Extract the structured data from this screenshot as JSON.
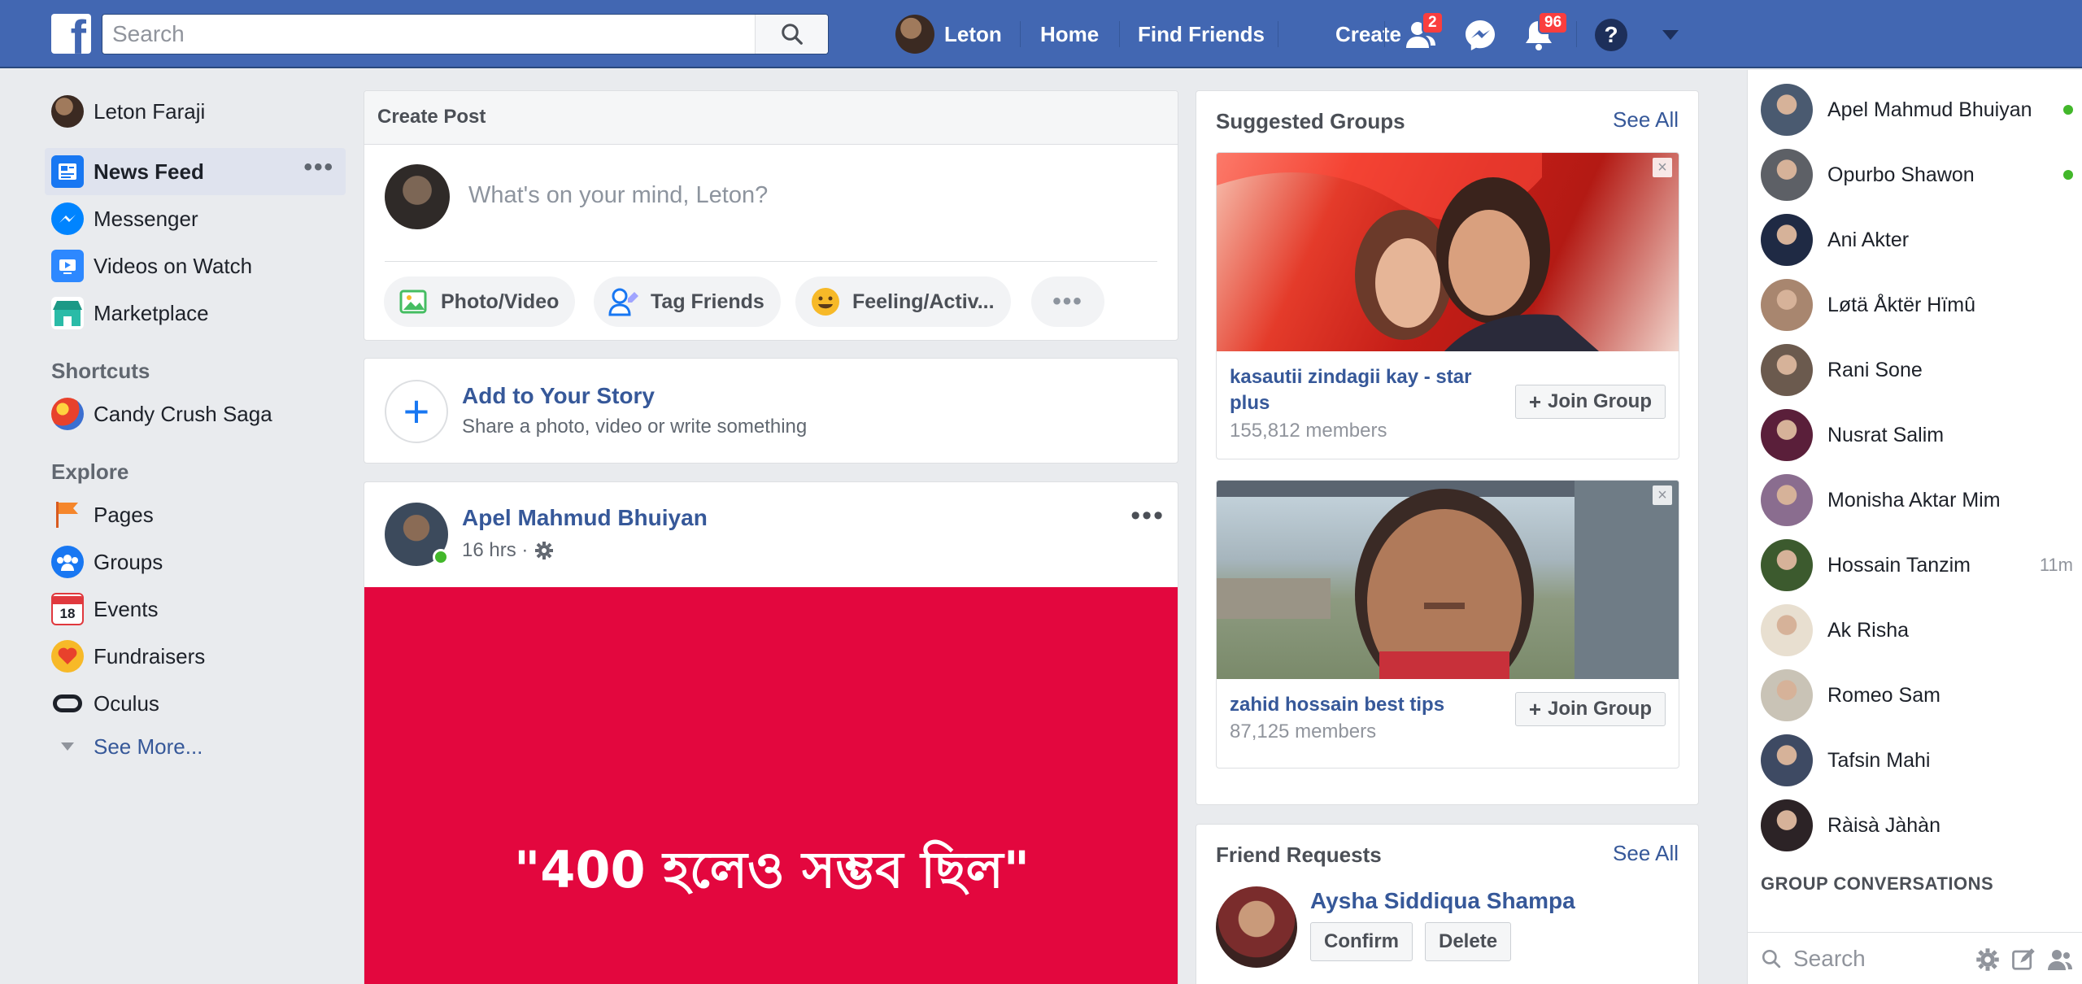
{
  "topbar": {
    "logo": "f",
    "search_placeholder": "Search",
    "profile_name": "Leton",
    "nav": [
      "Home",
      "Find Friends",
      "Create"
    ],
    "friend_requests_badge": "2",
    "notifications_badge": "96",
    "help_label": "?"
  },
  "left_nav": {
    "profile_name": "Leton Faraji",
    "items": [
      "News Feed",
      "Messenger",
      "Videos on Watch",
      "Marketplace"
    ],
    "shortcuts_heading": "Shortcuts",
    "shortcuts": [
      "Candy Crush Saga"
    ],
    "explore_heading": "Explore",
    "explore": [
      "Pages",
      "Groups",
      "Events",
      "Fundraisers",
      "Oculus"
    ],
    "see_more": "See More...",
    "more_dots": "•••",
    "events_day": "18"
  },
  "create_post": {
    "title": "Create Post",
    "placeholder": "What's on your mind, Leton?",
    "actions": [
      "Photo/Video",
      "Tag Friends",
      "Feeling/Activ..."
    ],
    "more": "•••"
  },
  "story": {
    "title": "Add to Your Story",
    "subtitle": "Share a photo, video or write something",
    "plus": "+"
  },
  "post": {
    "author": "Apel Mahmud Bhuiyan",
    "time": "16 hrs ·",
    "menu": "•••",
    "body_text": "\"400 হলেও সম্ভব ছিল\""
  },
  "suggested_groups": {
    "title": "Suggested Groups",
    "see_all": "See All",
    "close": "×",
    "groups": [
      {
        "name": "kasautii zindagii kay - star plus",
        "members": "155,812 members",
        "join": "Join Group"
      },
      {
        "name": "zahid hossain best tips",
        "members": "87,125 members",
        "join": "Join Group"
      }
    ]
  },
  "friend_requests": {
    "title": "Friend Requests",
    "see_all": "See All",
    "name": "Aysha Siddiqua Shampa",
    "confirm": "Confirm",
    "delete": "Delete"
  },
  "chat": {
    "contacts": [
      {
        "name": "Apel Mahmud Bhuiyan",
        "status": "online",
        "color": "#4a5a70"
      },
      {
        "name": "Opurbo Shawon",
        "status": "online",
        "color": "#5d6066"
      },
      {
        "name": "Ani Akter",
        "status": "",
        "color": "#1f2a44"
      },
      {
        "name": "Løtä Åktër Hïmû",
        "status": "",
        "color": "#a8866f"
      },
      {
        "name": "Rani Sone",
        "status": "",
        "color": "#6b5a4e"
      },
      {
        "name": "Nusrat Salim",
        "status": "",
        "color": "#5a1f3a"
      },
      {
        "name": "Monisha Aktar Mim",
        "status": "",
        "color": "#8a6d8f"
      },
      {
        "name": "Hossain Tanzim",
        "status": "11m",
        "color": "#3c5a2e"
      },
      {
        "name": "Ak Risha",
        "status": "",
        "color": "#e8dfd0"
      },
      {
        "name": "Romeo Sam",
        "status": "",
        "color": "#c9c3b6"
      },
      {
        "name": "Tafsin Mahi",
        "status": "",
        "color": "#3e4a63"
      },
      {
        "name": "Ràisà Jàhàn",
        "status": "",
        "color": "#2c2326"
      }
    ],
    "group_conversations": "GROUP CONVERSATIONS",
    "search_placeholder": "Search"
  },
  "colors": {
    "brand": "#4267b2",
    "link": "#365899",
    "post_background": "#e3073e",
    "online": "#42b72a",
    "badge": "#fa3e3e"
  }
}
